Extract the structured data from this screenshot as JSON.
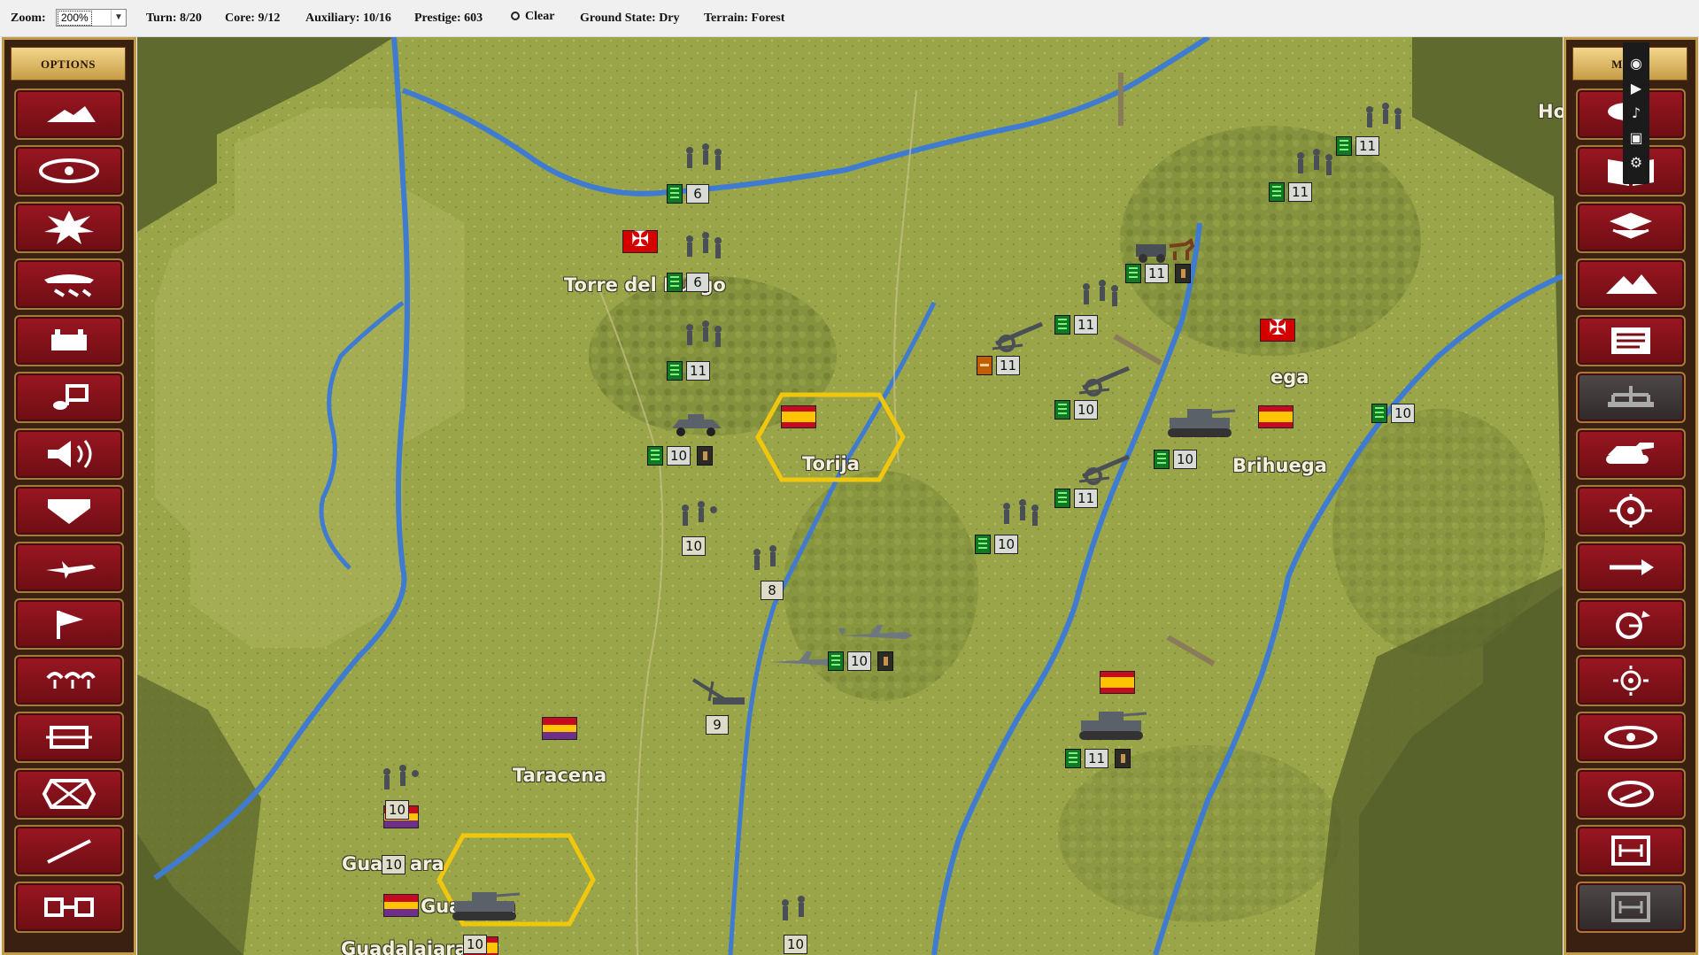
{
  "topbar": {
    "zoom_label": "Zoom:",
    "zoom_value": "200%",
    "turn": "Turn: 8/20",
    "core": "Core: 9/12",
    "auxiliary": "Auxiliary: 10/16",
    "prestige": "Prestige: 603",
    "weather": "Clear",
    "ground_state": "Ground State: Dry",
    "terrain": "Terrain: Forest"
  },
  "left_panel": {
    "header": "OPTIONS",
    "buttons": [
      "terrain",
      "line-of-sight",
      "explosion",
      "air-units",
      "supply",
      "sound",
      "loudspeaker",
      "shield",
      "aircraft",
      "flag",
      "purchase",
      "frame",
      "hex-grid",
      "arrow-line",
      "link"
    ]
  },
  "right_panel": {
    "header": "MENU",
    "buttons": [
      "unit-info",
      "book",
      "layers",
      "mountains",
      "news",
      "hierarchy",
      "tank",
      "target",
      "next-unit",
      "end-turn-clock",
      "scope",
      "observe",
      "deploy",
      "embark",
      "disembark"
    ]
  },
  "map": {
    "cities": [
      {
        "name": "Torre del Burgo",
        "owner": "germany"
      },
      {
        "name": "Torija",
        "owner": "spain"
      },
      {
        "name": "Brihuega",
        "owner": "spain"
      },
      {
        "name": "Taracena",
        "owner": "republic"
      },
      {
        "name": "Guadalajara",
        "owner": "spain"
      }
    ],
    "partial_labels": [
      "Ho",
      "ega",
      "Gua",
      "ara",
      "Gua",
      "ara",
      "Guadalajara"
    ],
    "units": [
      {
        "type": "infantry",
        "strength": "6",
        "badge": "green"
      },
      {
        "type": "infantry",
        "strength": "6",
        "badge": "green"
      },
      {
        "type": "infantry",
        "strength": "11",
        "badge": "green"
      },
      {
        "type": "infantry",
        "strength": "11",
        "badge": "green"
      },
      {
        "type": "infantry",
        "strength": "11",
        "badge": "green"
      },
      {
        "type": "horse-artillery",
        "strength": "11",
        "badge": "green"
      },
      {
        "type": "infantry",
        "strength": "11",
        "badge": "green"
      },
      {
        "type": "artillery",
        "strength": "11",
        "badge": "orange"
      },
      {
        "type": "artillery",
        "strength": "10",
        "badge": "green"
      },
      {
        "type": "armored-car",
        "strength": "10",
        "badge": "green"
      },
      {
        "type": "artillery",
        "strength": "11",
        "badge": "green"
      },
      {
        "type": "infantry",
        "strength": "10",
        "badge": "green"
      },
      {
        "type": "infantry",
        "strength": "10",
        "badge": "none"
      },
      {
        "type": "infantry",
        "strength": "8",
        "badge": "none"
      },
      {
        "type": "tank",
        "strength": "10",
        "badge": "green"
      },
      {
        "type": "infantry",
        "strength": "10",
        "badge": "green"
      },
      {
        "type": "aircraft",
        "strength": "10",
        "badge": "green"
      },
      {
        "type": "anti-air",
        "strength": "9",
        "badge": "none"
      },
      {
        "type": "tank",
        "strength": "11",
        "badge": "green"
      },
      {
        "type": "infantry",
        "strength": "10",
        "badge": "none"
      },
      {
        "type": "infantry",
        "strength": "10",
        "badge": "none"
      },
      {
        "type": "tank",
        "strength": "10",
        "badge": "none"
      },
      {
        "type": "infantry",
        "strength": "10",
        "badge": "none"
      }
    ]
  },
  "float_toolbar": [
    "camera-icon",
    "video-icon",
    "mic-icon",
    "window-icon",
    "gear-icon"
  ]
}
